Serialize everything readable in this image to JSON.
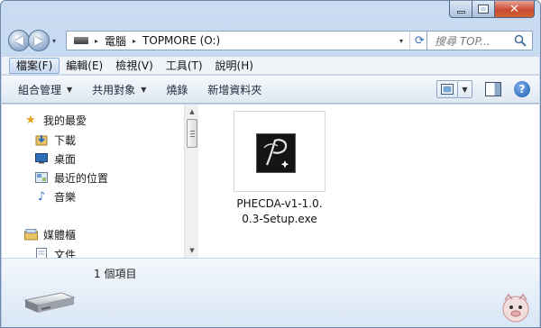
{
  "window": {
    "caption_min": "—",
    "caption_close": "✕"
  },
  "navigation": {
    "back_arrow": "◀",
    "forward_arrow": "▶",
    "dropdown_glyph": "▾"
  },
  "address_bar": {
    "separator": "▸",
    "segments": [
      "電腦",
      "TOPMORE (O:)"
    ],
    "refresh_glyph": "⟳"
  },
  "search": {
    "placeholder": "搜尋 TOP..."
  },
  "menu_bar": {
    "items": [
      "檔案(F)",
      "編輯(E)",
      "檢視(V)",
      "工具(T)",
      "說明(H)"
    ]
  },
  "command_bar": {
    "items": [
      {
        "label": "組合管理",
        "has_dropdown": true
      },
      {
        "label": "共用對象",
        "has_dropdown": true
      },
      {
        "label": "燒錄",
        "has_dropdown": false
      },
      {
        "label": "新增資料夾",
        "has_dropdown": false
      }
    ],
    "dropdown_glyph": "▼",
    "help_glyph": "?"
  },
  "nav_pane": {
    "favorites_label": "我的最愛",
    "favorites_items": [
      "下載",
      "桌面",
      "最近的位置",
      "音樂"
    ],
    "libraries_label": "媒體櫃",
    "libraries_items": [
      "文件"
    ],
    "scroll_up": "▲",
    "scroll_down": "▼"
  },
  "files": [
    {
      "name_line1": "PHECDA-v1-1.0.",
      "name_line2": "0.3-Setup.exe",
      "icon": "phecda-installer-icon"
    }
  ],
  "details_pane": {
    "item_count": "1 個項目",
    "drive_icon": "usb-drive-icon"
  },
  "colors": {
    "chrome": "#c9dcf2",
    "menu_bar": "#f0f3f8",
    "selection_border": "#8fb0d8"
  }
}
